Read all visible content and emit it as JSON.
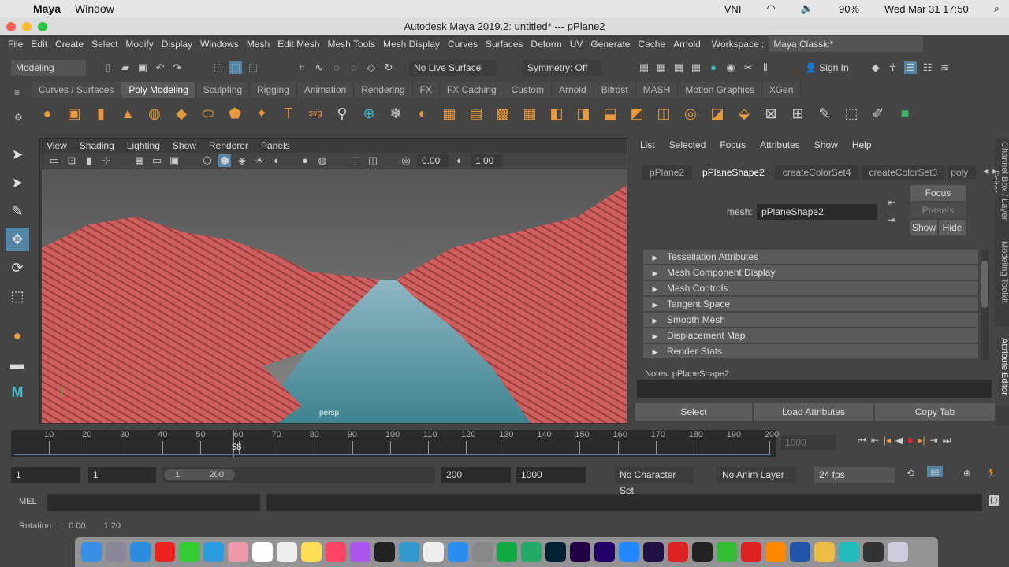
{
  "mac": {
    "app": "Maya",
    "menu": [
      "Window"
    ],
    "status": {
      "input": "VNI",
      "battery": "90%",
      "datetime": "Wed Mar 31  17:50"
    }
  },
  "window_title": "Autodesk Maya 2019.2: untitled*  ---  pPlane2",
  "menus": [
    "File",
    "Edit",
    "Create",
    "Select",
    "Modify",
    "Display",
    "Windows",
    "Mesh",
    "Edit Mesh",
    "Mesh Tools",
    "Mesh Display",
    "Curves",
    "Surfaces",
    "Deform",
    "UV",
    "Generate",
    "Cache",
    "Arnold"
  ],
  "workspace": {
    "label": "Workspace :",
    "value": "Maya Classic*"
  },
  "status_line": {
    "menuset": "Modeling",
    "live_surface": "No Live Surface",
    "symmetry": "Symmetry: Off",
    "sign_in": "Sign In"
  },
  "shelf_tabs": [
    "Curves / Surfaces",
    "Poly Modeling",
    "Sculpting",
    "Rigging",
    "Animation",
    "Rendering",
    "FX",
    "FX Caching",
    "Custom",
    "Arnold",
    "Bifrost",
    "MASH",
    "Motion Graphics",
    "XGen"
  ],
  "shelf_active": "Poly Modeling",
  "viewport": {
    "menus": [
      "View",
      "Shading",
      "Lighting",
      "Show",
      "Renderer",
      "Panels"
    ],
    "field1": "0.00",
    "field2": "1.00",
    "camera": "persp"
  },
  "attribute_editor": {
    "menus": [
      "List",
      "Selected",
      "Focus",
      "Attributes",
      "Show",
      "Help"
    ],
    "tabs": [
      "pPlane2",
      "pPlaneShape2",
      "createColorSet4",
      "createColorSet3",
      "poly"
    ],
    "active_tab": "pPlaneShape2",
    "mesh_label": "mesh:",
    "mesh_value": "pPlaneShape2",
    "focus": "Focus",
    "presets": "Presets",
    "show": "Show",
    "hide": "Hide",
    "sections": [
      "Tessellation Attributes",
      "Mesh Component Display",
      "Mesh Controls",
      "Tangent Space",
      "Smooth Mesh",
      "Displacement Map",
      "Render Stats"
    ],
    "notes": "Notes:  pPlaneShape2",
    "buttons": [
      "Select",
      "Load Attributes",
      "Copy Tab"
    ]
  },
  "side_tabs": [
    "Channel Box / Layer Editor",
    "Modeling Toolkit",
    "Attribute Editor"
  ],
  "timeline": {
    "ticks": [
      10,
      20,
      30,
      40,
      50,
      60,
      70,
      80,
      90,
      100,
      110,
      120,
      130,
      140,
      150,
      160,
      170,
      180,
      190,
      200
    ],
    "current_frame": "58",
    "end_field": "1000"
  },
  "range": {
    "start": "1",
    "playback_start": "1",
    "slider_start": "1",
    "slider_end": "200",
    "playback_end": "200",
    "end": "1000",
    "character_set": "No Character Set",
    "anim_layer": "No Anim Layer",
    "fps": "24 fps"
  },
  "command_line": {
    "label": "MEL"
  },
  "help_line": {
    "label": "Rotation:",
    "v1": "0.00",
    "v2": "1.20"
  }
}
